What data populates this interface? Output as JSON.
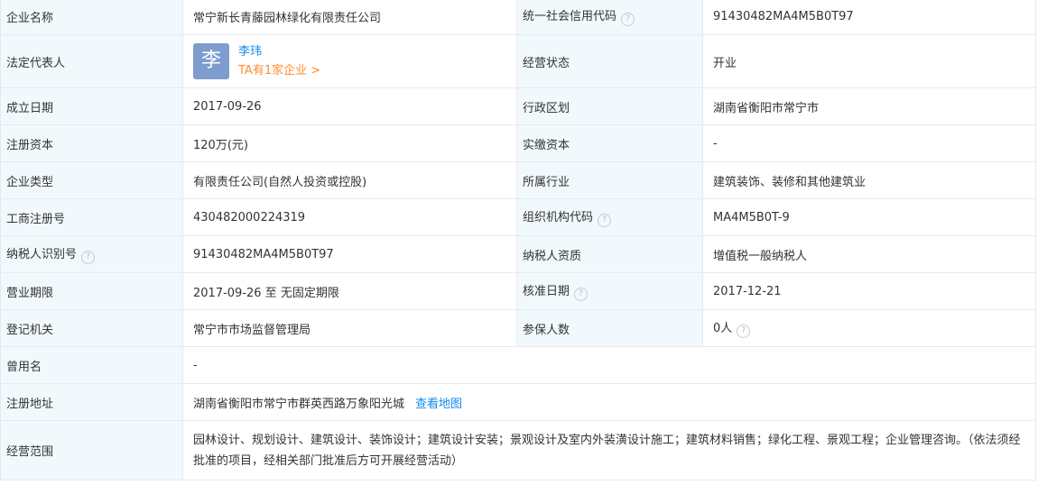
{
  "rows": [
    {
      "l1": "企业名称",
      "v1": "常宁新长青藤园林绿化有限责任公司",
      "l2": "统一社会信用代码",
      "v2": "91430482MA4M5B0T97"
    },
    {
      "l1": "法定代表人",
      "l2": "经营状态",
      "v2": "开业"
    },
    {
      "l1": "成立日期",
      "v1": "2017-09-26",
      "l2": "行政区划",
      "v2": "湖南省衡阳市常宁市"
    },
    {
      "l1": "注册资本",
      "v1": "120万(元)",
      "l2": "实缴资本",
      "v2": "-"
    },
    {
      "l1": "企业类型",
      "v1": "有限责任公司(自然人投资或控股)",
      "l2": "所属行业",
      "v2": "建筑装饰、装修和其他建筑业"
    },
    {
      "l1": "工商注册号",
      "v1": "430482000224319",
      "l2": "组织机构代码",
      "v2": "MA4M5B0T-9"
    },
    {
      "l1": "纳税人识别号",
      "v1": "91430482MA4M5B0T97",
      "l2": "纳税人资质",
      "v2": "增值税一般纳税人"
    },
    {
      "l1": "营业期限",
      "v1": "2017-09-26 至 无固定期限",
      "l2": "核准日期",
      "v2": "2017-12-21"
    },
    {
      "l1": "登记机关",
      "v1": "常宁市市场监督管理局",
      "l2": "参保人数",
      "v2": "0人"
    },
    {
      "l1": "曾用名",
      "v1": "-"
    },
    {
      "l1": "注册地址",
      "v1": "湖南省衡阳市常宁市群英西路万象阳光城",
      "link": "查看地图"
    },
    {
      "l1": "经营范围",
      "v1": "园林设计、规划设计、建筑设计、装饰设计；建筑设计安装；景观设计及室内外装潢设计施工；建筑材料销售；绿化工程、景观工程；企业管理咨询。（依法须经批准的项目，经相关部门批准后方可开展经营活动）"
    }
  ],
  "legal_rep": {
    "avatar_char": "李",
    "name": "李玮",
    "companies_link": "TA有1家企业 >"
  },
  "help_icon": "?",
  "colors": {
    "label_bg": "#f2f9fc",
    "border": "#e4eaf1",
    "link": "#128bed",
    "orange_link": "#fd8d2f",
    "avatar_bg": "#7f9ccf"
  }
}
